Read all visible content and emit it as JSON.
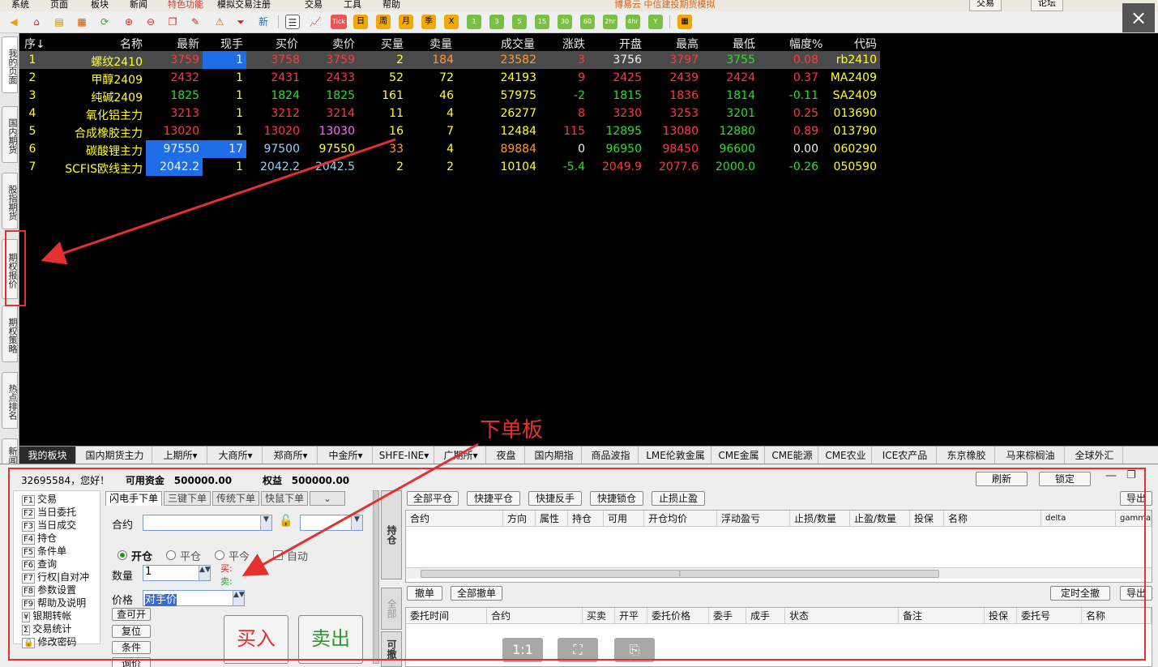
{
  "menu": {
    "items": [
      "系统",
      "页面",
      "板块",
      "新闻",
      "特色功能",
      "模拟交易注册",
      "交易",
      "工具",
      "帮助"
    ],
    "promo": "博易云 中信建投期货模拟",
    "trade_btn": "交易",
    "forum_btn": "论坛"
  },
  "toolbar": {
    "new_label": "新",
    "tick_label": "Tick",
    "period_labels": [
      "日",
      "周",
      "月",
      "季",
      "X",
      "1",
      "3",
      "5",
      "15",
      "30",
      "60",
      "2hr",
      "4hr",
      "Y"
    ],
    "close_label": "×"
  },
  "left_tabs": [
    "我的页面",
    "国内期货",
    "股指期货",
    "期权报价",
    "期权策略",
    "热点排名",
    "新闻资讯"
  ],
  "table": {
    "headers": [
      "序↓",
      "名称",
      "最新",
      "现手",
      "买价",
      "卖价",
      "买量",
      "卖量",
      "成交量",
      "涨跌",
      "开盘",
      "最高",
      "最低",
      "幅度%",
      "代码"
    ],
    "rows": [
      {
        "seq": "1",
        "name": "螺纹2410",
        "last": "3759",
        "vol_now": "1",
        "bid": "3758",
        "ask": "3759",
        "bid_qty": "2",
        "ask_qty": "184",
        "volume": "23582",
        "change": "3",
        "open": "3756",
        "high": "3797",
        "low": "3755",
        "pct": "0.08",
        "code": "rb2410"
      },
      {
        "seq": "2",
        "name": "甲醇2409",
        "last": "2432",
        "vol_now": "1",
        "bid": "2431",
        "ask": "2433",
        "bid_qty": "52",
        "ask_qty": "72",
        "volume": "24193",
        "change": "9",
        "open": "2425",
        "high": "2439",
        "low": "2424",
        "pct": "0.37",
        "code": "MA2409"
      },
      {
        "seq": "3",
        "name": "纯碱2409",
        "last": "1825",
        "vol_now": "1",
        "bid": "1824",
        "ask": "1825",
        "bid_qty": "161",
        "ask_qty": "46",
        "volume": "57975",
        "change": "-2",
        "open": "1815",
        "high": "1836",
        "low": "1814",
        "pct": "-0.11",
        "code": "SA2409"
      },
      {
        "seq": "4",
        "name": "氧化铝主力",
        "last": "3213",
        "vol_now": "1",
        "bid": "3212",
        "ask": "3214",
        "bid_qty": "11",
        "ask_qty": "4",
        "volume": "26277",
        "change": "8",
        "open": "3230",
        "high": "3253",
        "low": "3201",
        "pct": "0.25",
        "code": "013690"
      },
      {
        "seq": "5",
        "name": "合成橡胶主力",
        "last": "13020",
        "vol_now": "1",
        "bid": "13020",
        "ask": "13030",
        "bid_qty": "16",
        "ask_qty": "7",
        "volume": "12484",
        "change": "115",
        "open": "12895",
        "high": "13080",
        "low": "12880",
        "pct": "0.89",
        "code": "013790"
      },
      {
        "seq": "6",
        "name": "碳酸锂主力",
        "last": "97550",
        "vol_now": "17",
        "bid": "97500",
        "ask": "97550",
        "bid_qty": "33",
        "ask_qty": "4",
        "volume": "89884",
        "change": "0",
        "open": "96950",
        "high": "98450",
        "low": "96600",
        "pct": "0.00",
        "code": "060290"
      },
      {
        "seq": "7",
        "name": "SCFIS欧线主力",
        "last": "2042.2",
        "vol_now": "1",
        "bid": "2042.2",
        "ask": "2042.5",
        "bid_qty": "2",
        "ask_qty": "2",
        "volume": "10104",
        "change": "-5.4",
        "open": "2049.9",
        "high": "2077.6",
        "low": "2000.0",
        "pct": "-0.26",
        "code": "050590"
      }
    ]
  },
  "annotation": {
    "order_panel_label": "下单板"
  },
  "market_tabs": [
    "我的板块",
    "国内期货主力",
    "上期所▾",
    "大商所▾",
    "郑商所▾",
    "中金所▾",
    "SHFE-INE▾",
    "广期所▾",
    "夜盘",
    "国内期指",
    "商品波指",
    "LME伦敦金属",
    "CME金属",
    "CME能源",
    "CME农业",
    "ICE农产品",
    "东京橡胶",
    "马来棕榈油",
    "全球外汇"
  ],
  "order_panel": {
    "greeting": "32695584，您好！",
    "avail_label": "可用资金",
    "avail_value": "500000.00",
    "equity_label": "权益",
    "equity_value": "500000.00",
    "refresh": "刷新",
    "lock": "锁定",
    "functions": [
      {
        "key": "F1",
        "label": "交易"
      },
      {
        "key": "F2",
        "label": "当日委托"
      },
      {
        "key": "F3",
        "label": "当日成交"
      },
      {
        "key": "F4",
        "label": "持仓"
      },
      {
        "key": "F5",
        "label": "条件单"
      },
      {
        "key": "F6",
        "label": "查询"
      },
      {
        "key": "F7",
        "label": "行权|自对冲"
      },
      {
        "key": "F8",
        "label": "参数设置"
      },
      {
        "key": "F9",
        "label": "帮助及说明"
      },
      {
        "key": "¥",
        "label": "银期转帐"
      },
      {
        "key": "Σ",
        "label": "交易统计"
      },
      {
        "key": "🔒",
        "label": "修改密码"
      }
    ],
    "order_tabs": [
      "闪电手下单",
      "三键下单",
      "传统下单",
      "快鼠下单"
    ],
    "contract_label": "合约",
    "radio_open": "开仓",
    "radio_close": "平仓",
    "radio_today": "平今",
    "auto_label": "自动",
    "qty_label": "数量",
    "qty_value": "1",
    "buy_hint": "买:",
    "sell_hint": "卖:",
    "price_label": "价格",
    "price_value": "对手价",
    "btn_query": "查可开",
    "btn_reset": "复位",
    "btn_cond": "条件",
    "btn_inquiry": "询价",
    "buy": "买入",
    "sell": "卖出",
    "position_tab": "持仓",
    "all_tab": "全部",
    "cancelable_tab": "可撤",
    "pos_buttons": [
      "全部平仓",
      "快捷平仓",
      "快捷反手",
      "快捷锁仓",
      "止损止盈"
    ],
    "export": "导出",
    "pos_headers": [
      "合约",
      "方向",
      "属性",
      "持仓",
      "可用",
      "开仓均价",
      "浮动盈亏",
      "止损/数量",
      "止盈/数量",
      "投保",
      "名称",
      "delta",
      "gamma"
    ],
    "ord_buttons": [
      "撤单",
      "全部撤单"
    ],
    "timed_cancel": "定时全撤",
    "ord_headers": [
      "委托时间",
      "合约",
      "买卖",
      "开平",
      "委托价格",
      "委手",
      "成手",
      "状态",
      "备注",
      "投保",
      "委托号",
      "名称"
    ],
    "overlay_icons": [
      "1:1",
      "fit-icon",
      "screenshot-icon"
    ]
  }
}
